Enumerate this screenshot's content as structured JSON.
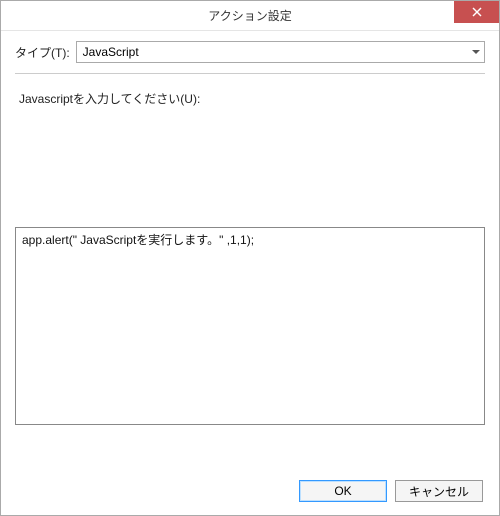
{
  "window": {
    "title": "アクション設定"
  },
  "type": {
    "label": "タイプ(T):",
    "selected": "JavaScript"
  },
  "prompt": {
    "label": "Javascriptを入力してください(U):"
  },
  "code": {
    "value": "app.alert(\" JavaScriptを実行します。\" ,1,1);"
  },
  "buttons": {
    "ok": "OK",
    "cancel": "キャンセル"
  }
}
